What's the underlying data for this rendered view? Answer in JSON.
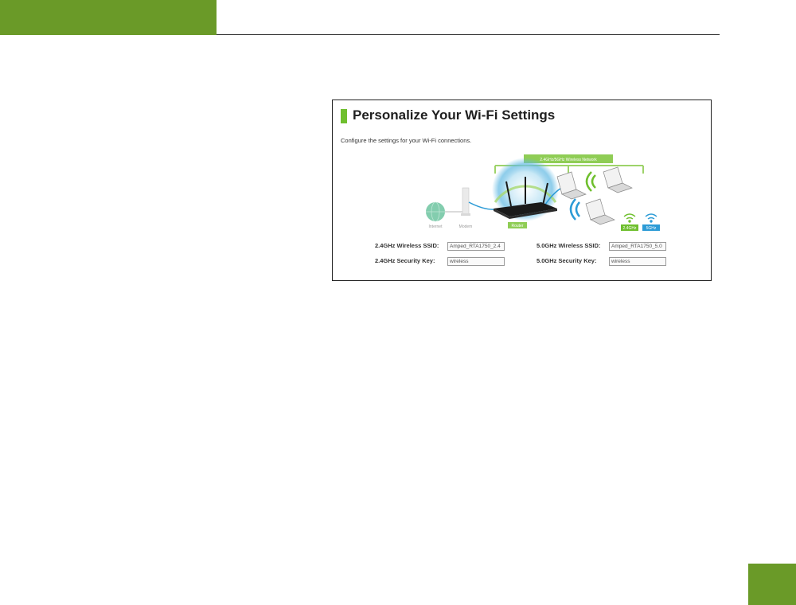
{
  "panel": {
    "title": "Personalize Your Wi-Fi Settings",
    "subtitle": "Configure the settings for your Wi-Fi connections."
  },
  "diagram": {
    "network_label": "2.4GHz/5GHz Wireless Network",
    "internet_label": "Internet",
    "modem_label": "Modem",
    "router_label": "Router",
    "band_24_label": "2.4GHz",
    "band_5_label": "5GHz",
    "icons": [
      "globe-icon",
      "modem-icon",
      "router-icon",
      "laptop-icon",
      "wifi-icon"
    ]
  },
  "form": {
    "ssid_24_label": "2.4GHz Wireless SSID:",
    "ssid_24_value": "Amped_RTA1750_2.4",
    "key_24_label": "2.4GHz Security Key:",
    "key_24_value": "wireless",
    "ssid_5_label": "5.0GHz Wireless SSID:",
    "ssid_5_value": "Amped_RTA1750_5.0",
    "key_5_label": "5.0GHz Security Key:",
    "key_5_value": "wireless"
  },
  "colors": {
    "header_green": "#6a9a28",
    "accent_green": "#6fbf2e",
    "wifi_blue": "#2c9bd6"
  }
}
